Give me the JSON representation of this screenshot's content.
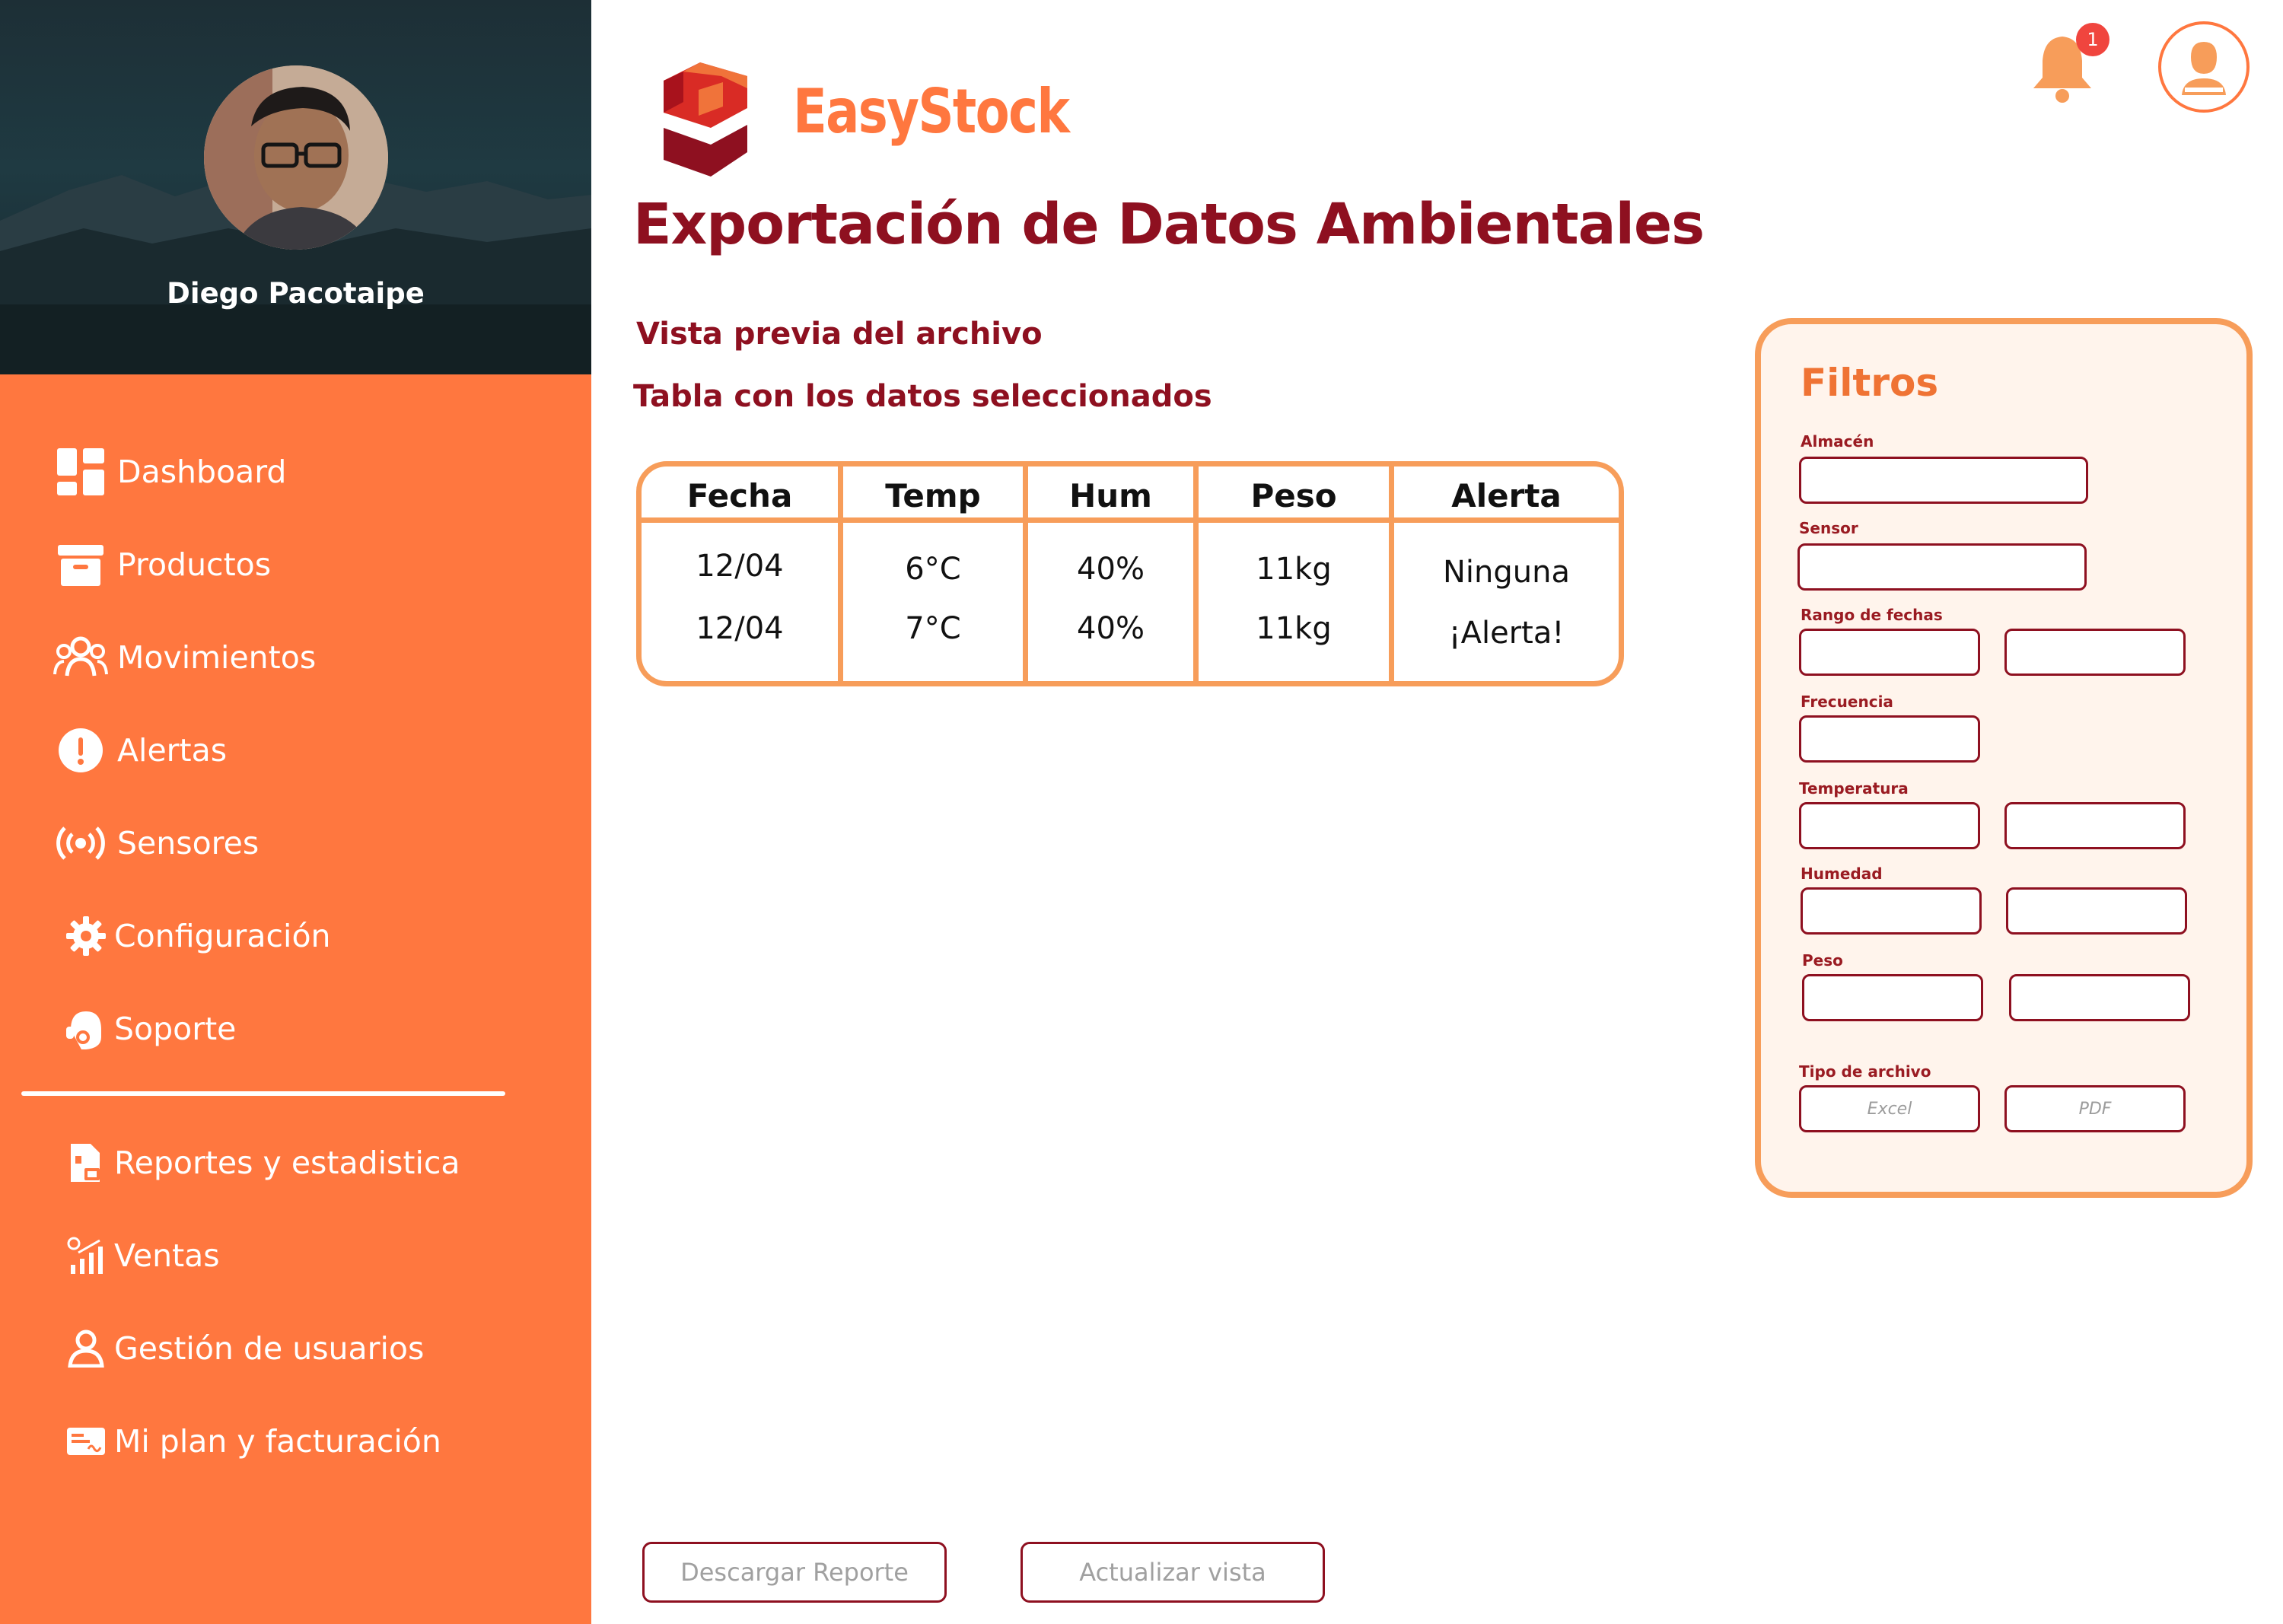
{
  "app": {
    "brand": "EasyStock"
  },
  "profile": {
    "name": "Diego Pacotaipe"
  },
  "sidebar": {
    "items": [
      {
        "label": "Dashboard",
        "icon": "dashboard-icon"
      },
      {
        "label": "Productos",
        "icon": "archive-box-icon"
      },
      {
        "label": "Movimientos",
        "icon": "users-group-icon"
      },
      {
        "label": "Alertas",
        "icon": "alert-circle-icon"
      },
      {
        "label": "Sensores",
        "icon": "broadcast-icon"
      },
      {
        "label": "Configuración",
        "icon": "gear-icon"
      },
      {
        "label": "Soporte",
        "icon": "support-headset-icon"
      }
    ],
    "secondary": [
      {
        "label": "Reportes y estadistica",
        "icon": "report-file-icon"
      },
      {
        "label": "Ventas",
        "icon": "sales-chart-icon"
      },
      {
        "label": "Gestión de usuarios",
        "icon": "user-manage-icon"
      },
      {
        "label": "Mi plan y facturación",
        "icon": "billing-card-icon"
      }
    ]
  },
  "header": {
    "title": "Exportación de Datos Ambientales",
    "preview_label": "Vista previa del archivo",
    "table_label": "Tabla con los datos seleccionados",
    "notifications_count": "1"
  },
  "table": {
    "headers": [
      "Fecha",
      "Temp",
      "Hum",
      "Peso",
      "Alerta"
    ],
    "rows": [
      [
        "12/04",
        "6°C",
        "40%",
        "11kg",
        "Ninguna"
      ],
      [
        "12/04",
        "7°C",
        "40%",
        "11kg",
        "¡Alerta!"
      ]
    ]
  },
  "filters": {
    "title": "Filtros",
    "almacen": "Almacén",
    "sensor": "Sensor",
    "rango_fechas": "Rango de fechas",
    "frecuencia": "Frecuencia",
    "temperatura": "Temperatura",
    "humedad": "Humedad",
    "peso": "Peso",
    "tipo_archivo": "Tipo de archivo",
    "excel": "Excel",
    "pdf": "PDF"
  },
  "actions": {
    "download": "Descargar Reporte",
    "refresh": "Actualizar vista"
  },
  "colors": {
    "sidebar": "#ff773f",
    "title": "#8e1020",
    "accent": "#f79d5a",
    "panel_bg": "#fff4ec"
  }
}
